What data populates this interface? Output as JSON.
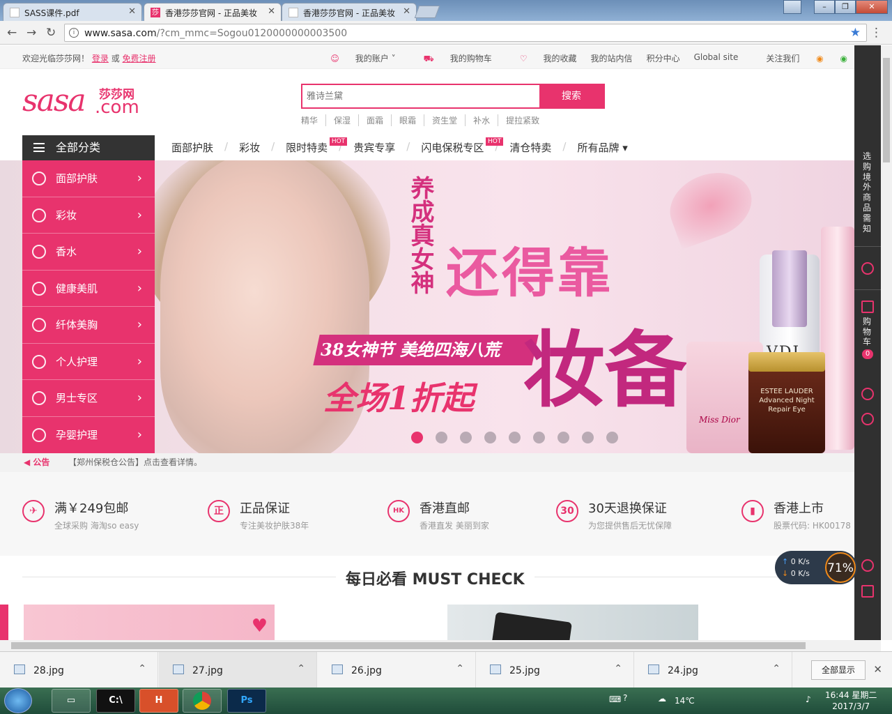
{
  "browser": {
    "tabs": [
      {
        "title": "SASS课件.pdf",
        "active": false
      },
      {
        "title": "香港莎莎官网 - 正品美妆",
        "active": true
      },
      {
        "title": "香港莎莎官网 - 正品美妆",
        "active": false
      }
    ],
    "favicon_sasa": "莎",
    "address": {
      "host": "www.sasa.com",
      "path": "/?cm_mmc=Sogou0120000000003500"
    }
  },
  "topbar": {
    "welcome": "欢迎光临莎莎网！",
    "login": "登录",
    "or": "或",
    "register": "免费注册",
    "links": [
      "我的账户",
      "我的购物车",
      "我的收藏",
      "我的站内信",
      "积分中心",
      "Global site",
      "关注我们"
    ]
  },
  "logo": {
    "main": "sasa",
    "cn": "莎莎网",
    "com": ".com"
  },
  "search": {
    "placeholder": "雅诗兰黛",
    "button": "搜索",
    "hotwords": [
      "精华",
      "保湿",
      "面霜",
      "眼霜",
      "资生堂",
      "补水",
      "提拉紧致"
    ]
  },
  "categories": {
    "header": "全部分类",
    "items": [
      "面部护肤",
      "彩妆",
      "香水",
      "健康美肌",
      "纤体美胸",
      "个人护理",
      "男士专区",
      "孕婴护理"
    ]
  },
  "mainnav": [
    {
      "label": "面部护肤",
      "hot": false
    },
    {
      "label": "彩妆",
      "hot": false
    },
    {
      "label": "限时特卖",
      "hot": true
    },
    {
      "label": "贵宾专享",
      "hot": false
    },
    {
      "label": "闪电保税专区",
      "hot": true
    },
    {
      "label": "清仓特卖",
      "hot": false
    },
    {
      "label": "所有品牌 ▾",
      "hot": false
    }
  ],
  "hot_badge": "HOT",
  "banner": {
    "vertical": "养成真女神",
    "big1": "还得靠",
    "big2": "妆备",
    "ribbon": "38女神节 美绝四海八荒",
    "sale": "全场1折起",
    "bottle_vdl": "VDL",
    "bottle_dior": "Miss Dior",
    "bottle_estee": "ESTEE LAUDER Advanced Night Repair Eye",
    "dots": 9,
    "active_dot": 0
  },
  "notice": {
    "label": "公告",
    "text": "【郑州保税仓公告】点击查看详情。"
  },
  "guarantees": [
    {
      "icon": "✈",
      "title": "满￥249包邮",
      "sub": "全球采购 海淘so easy"
    },
    {
      "icon": "正",
      "title": "正品保证",
      "sub": "专注美妆护肤38年"
    },
    {
      "icon": "HK",
      "title": "香港直邮",
      "sub": "香港直发 美丽到家"
    },
    {
      "icon": "30",
      "title": "30天退换保证",
      "sub": "为您提供售后无忧保障"
    },
    {
      "icon": "▮",
      "title": "香港上市",
      "sub": "股票代码: HK00178"
    }
  ],
  "mustcheck": "每日必看 MUST CHECK",
  "dock": {
    "notice": "选购境外商品需知",
    "cart": "购物车",
    "cart_count": "0"
  },
  "netmon": {
    "up": "0 K/s",
    "down": "0 K/s",
    "pct": "71%"
  },
  "downloads": {
    "files": [
      "28.jpg",
      "27.jpg",
      "26.jpg",
      "25.jpg",
      "24.jpg"
    ],
    "show_all": "全部显示"
  },
  "taskbar": {
    "temp": "14℃",
    "time": "16:44 星期二",
    "date": "2017/3/7",
    "apps": [
      "C:\\",
      "H",
      "Chrome",
      "Ps"
    ]
  },
  "colors": {
    "brand": "#e8336d",
    "dark": "#333333"
  }
}
